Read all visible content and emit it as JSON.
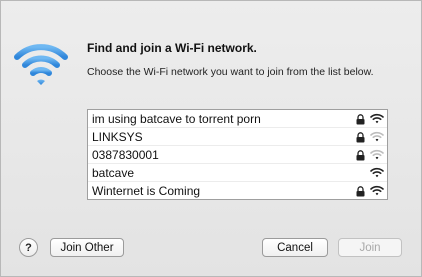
{
  "dialog": {
    "title": "Find and join a Wi-Fi network.",
    "subtitle": "Choose the Wi-Fi network you want to join from the list below."
  },
  "networks": [
    {
      "name": "im using batcave to torrent porn",
      "locked": true,
      "signal": 1.0
    },
    {
      "name": "LINKSYS",
      "locked": true,
      "signal": 0.33
    },
    {
      "name": "0387830001",
      "locked": true,
      "signal": 0.33
    },
    {
      "name": "batcave",
      "locked": false,
      "signal": 1.0
    },
    {
      "name": "Winternet is Coming",
      "locked": true,
      "signal": 1.0
    }
  ],
  "buttons": {
    "help": "?",
    "join_other": "Join Other",
    "cancel": "Cancel",
    "join": "Join"
  },
  "icons": {
    "wifi_logo": "wifi-icon",
    "lock": "lock-icon",
    "signal": "wifi-signal-icon"
  },
  "colors": {
    "wifi_logo": "#4a9fe8",
    "signal_strong": "#222222",
    "signal_weak": "#bdbdbd"
  }
}
